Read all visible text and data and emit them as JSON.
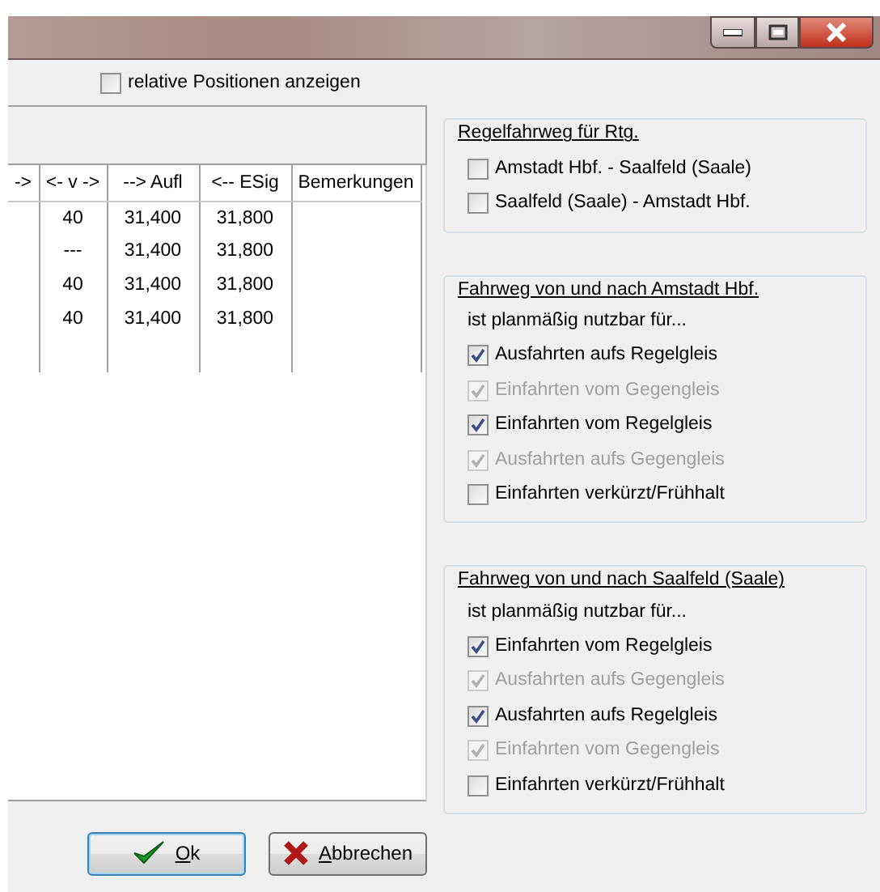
{
  "window": {
    "controls": [
      {
        "kind": "minimize"
      },
      {
        "kind": "maximize"
      },
      {
        "kind": "close"
      }
    ]
  },
  "relative_positions": {
    "label": "relative Positionen anzeigen",
    "checked": false
  },
  "table": {
    "columns": [
      {
        "label": "->"
      },
      {
        "label": "<- v ->"
      },
      {
        "label": "--> Aufl"
      },
      {
        "label": "<-- ESig"
      },
      {
        "label": "Bemerkungen"
      }
    ],
    "rows": [
      [
        "",
        "40",
        "31,400",
        "31,800"
      ],
      [
        "",
        "---",
        "31,400",
        "31,800"
      ],
      [
        "",
        "40",
        "31,400",
        "31,800"
      ],
      [
        "",
        "40",
        "31,400",
        "31,800"
      ]
    ]
  },
  "groups": [
    {
      "title": "Regelfahrweg für Rtg.",
      "items": [
        {
          "label": "Amstadt Hbf. - Saalfeld (Saale)",
          "checked": false,
          "disabled": false
        },
        {
          "label": "Saalfeld (Saale) - Amstadt Hbf.",
          "checked": false,
          "disabled": false
        }
      ]
    },
    {
      "title": "Fahrweg von und nach Amstadt Hbf.",
      "subtitle": "ist planmäßig nutzbar für...",
      "items": [
        {
          "label": "Ausfahrten aufs Regelgleis",
          "checked": true,
          "disabled": false
        },
        {
          "label": "Einfahrten vom Gegengleis",
          "checked": true,
          "disabled": true
        },
        {
          "label": "Einfahrten vom Regelgleis",
          "checked": true,
          "disabled": false
        },
        {
          "label": "Ausfahrten aufs Gegengleis",
          "checked": true,
          "disabled": true
        },
        {
          "label": "Einfahrten verkürzt/Frühhalt",
          "checked": false,
          "disabled": false
        }
      ]
    },
    {
      "title": "Fahrweg von und nach Saalfeld (Saale)",
      "subtitle": "ist planmäßig nutzbar für...",
      "items": [
        {
          "label": "Einfahrten vom Regelgleis",
          "checked": true,
          "disabled": false
        },
        {
          "label": "Ausfahrten aufs Gegengleis",
          "checked": true,
          "disabled": true
        },
        {
          "label": "Ausfahrten aufs Regelgleis",
          "checked": true,
          "disabled": false
        },
        {
          "label": "Einfahrten vom Gegengleis",
          "checked": true,
          "disabled": true
        },
        {
          "label": "Einfahrten verkürzt/Frühhalt",
          "checked": false,
          "disabled": false
        }
      ]
    }
  ],
  "buttons": [
    {
      "kind": "ok",
      "label": "Ok",
      "access_key_underlined": true,
      "focused": true
    },
    {
      "kind": "cancel",
      "label": "Abbrechen",
      "access_key_underlined": true,
      "focused": false
    }
  ]
}
